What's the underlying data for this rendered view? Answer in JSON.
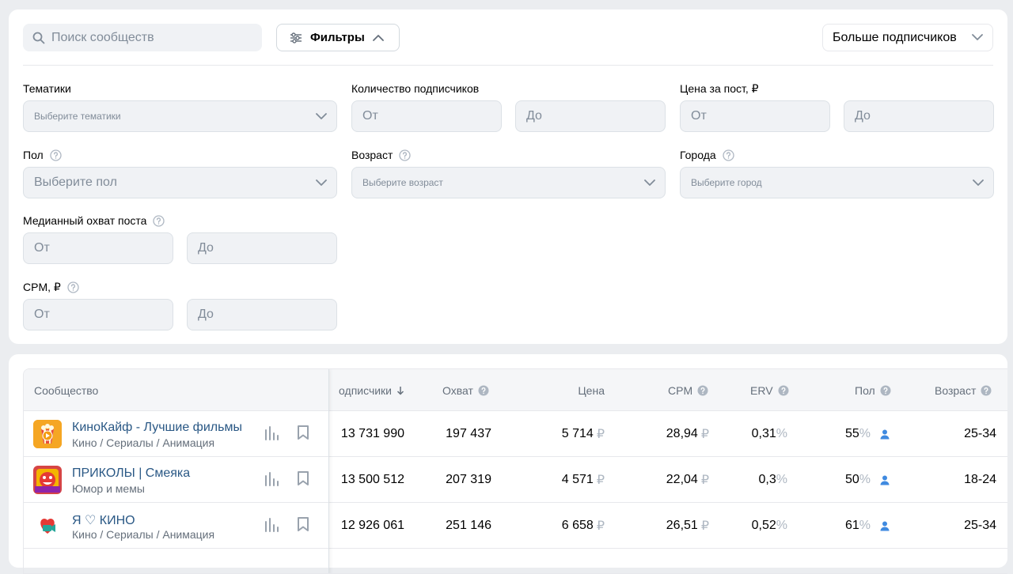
{
  "search": {
    "placeholder": "Поиск сообществ"
  },
  "filters_button": {
    "label": "Фильтры"
  },
  "sort": {
    "label": "Больше подписчиков"
  },
  "filters": {
    "topics": {
      "label": "Тематики",
      "placeholder": "Выберите тематики"
    },
    "subscribers": {
      "label": "Количество подписчиков",
      "from": "От",
      "to": "До"
    },
    "price": {
      "label": "Цена за пост, ₽",
      "from": "От",
      "to": "До"
    },
    "gender": {
      "label": "Пол",
      "placeholder": "Выберите пол"
    },
    "age": {
      "label": "Возраст",
      "placeholder": "Выберите возраст"
    },
    "cities": {
      "label": "Города",
      "placeholder": "Выберите город"
    },
    "reach": {
      "label": "Медианный охват поста",
      "from": "От",
      "to": "До"
    },
    "cpm": {
      "label": "CPM, ₽",
      "from": "От",
      "to": "До"
    }
  },
  "table": {
    "columns": {
      "community": "Сообщество",
      "subscribers": "одписчики",
      "reach": "Охват",
      "price": "Цена",
      "cpm": "CPM",
      "erv": "ERV",
      "gender": "Пол",
      "age": "Возраст"
    },
    "currency": "₽",
    "percent": "%",
    "rows": [
      {
        "name": "КиноКайф - Лучшие фильмы",
        "category": "Кино / Сериалы / Анимация",
        "subscribers": "13 731 990",
        "reach": "197 437",
        "price": "5 714",
        "cpm": "28,94",
        "erv": "0,31",
        "gender": "55",
        "age": "25-34"
      },
      {
        "name": "ПРИКОЛЫ | Смеяка",
        "category": "Юмор и мемы",
        "subscribers": "13 500 512",
        "reach": "207 319",
        "price": "4 571",
        "cpm": "22,04",
        "erv": "0,3",
        "gender": "50",
        "age": "18-24"
      },
      {
        "name": "Я ♡ КИНО",
        "category": "Кино / Сериалы / Анимация",
        "subscribers": "12 926 061",
        "reach": "251 146",
        "price": "6 658",
        "cpm": "26,51",
        "erv": "0,52",
        "gender": "61",
        "age": "25-34"
      }
    ]
  },
  "colors": {
    "accent_link": "#2a5885",
    "muted": "#818c99",
    "icon_blue": "#3f8ae0"
  }
}
